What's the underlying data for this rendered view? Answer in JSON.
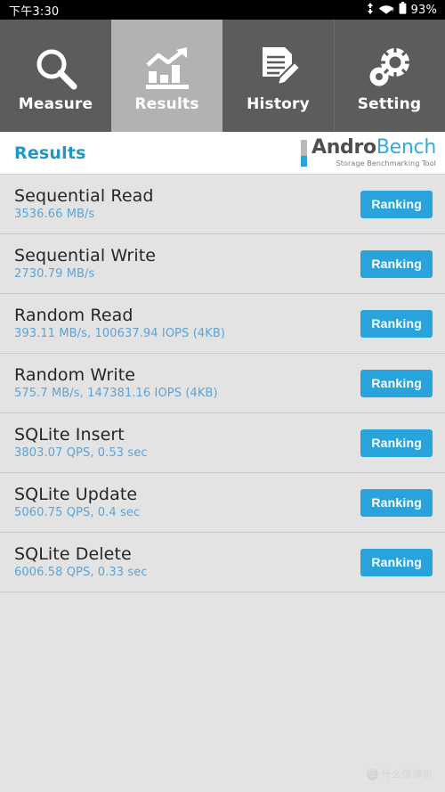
{
  "statusbar": {
    "time": "下午3:30",
    "battery_percent": "93%",
    "icons": [
      "data-transfer-icon",
      "wifi-icon",
      "battery-icon"
    ]
  },
  "tabs": [
    {
      "label": "Measure",
      "icon": "magnifier-icon",
      "active": false
    },
    {
      "label": "Results",
      "icon": "bar-chart-icon",
      "active": true
    },
    {
      "label": "History",
      "icon": "document-pencil-icon",
      "active": false
    },
    {
      "label": "Setting",
      "icon": "gears-icon",
      "active": false
    }
  ],
  "header": {
    "title": "Results",
    "logo_word1": "Andro",
    "logo_word2": "Bench",
    "logo_tagline": "Storage Benchmarking Tool"
  },
  "results": [
    {
      "title": "Sequential Read",
      "value": "3536.66 MB/s",
      "button": "Ranking"
    },
    {
      "title": "Sequential Write",
      "value": "2730.79 MB/s",
      "button": "Ranking"
    },
    {
      "title": "Random Read",
      "value": "393.11 MB/s, 100637.94 IOPS (4KB)",
      "button": "Ranking"
    },
    {
      "title": "Random Write",
      "value": "575.7 MB/s, 147381.16 IOPS (4KB)",
      "button": "Ranking"
    },
    {
      "title": "SQLite Insert",
      "value": "3803.07 QPS, 0.53 sec",
      "button": "Ranking"
    },
    {
      "title": "SQLite Update",
      "value": "5060.75 QPS, 0.4 sec",
      "button": "Ranking"
    },
    {
      "title": "SQLite Delete",
      "value": "6006.58 QPS, 0.33 sec",
      "button": "Ranking"
    }
  ],
  "watermark": {
    "badge": "值",
    "text": "什么值得买"
  },
  "colors": {
    "accent_blue": "#29a3dc",
    "title_blue": "#2196c9",
    "value_blue": "#5da3d4",
    "tab_inactive": "#5c5c5c",
    "tab_active": "#b2b2b2",
    "list_bg": "#e3e3e3"
  }
}
